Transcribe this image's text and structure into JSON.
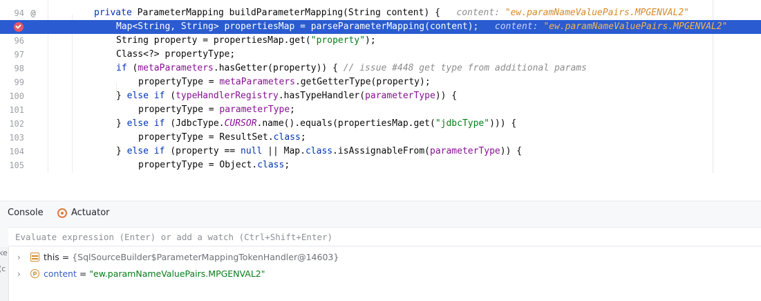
{
  "editor": {
    "lines": [
      {
        "num": "94",
        "marker": "@",
        "current": false,
        "indent": 136,
        "tokens": [
          {
            "t": "private ",
            "c": "k"
          },
          {
            "t": "ParameterMapping buildParameterMapping(String content) {",
            "c": ""
          }
        ],
        "hint_label": "content: ",
        "hint_value": "\"ew.paramNameValuePairs.MPGENVAL2\""
      },
      {
        "num": "",
        "marker": "",
        "current": true,
        "indent": 168,
        "breakpoint": true,
        "tokens": [
          {
            "t": "Map<String, String> propertiesMap = parseParameterMapping(content);",
            "c": ""
          }
        ],
        "hint_label": "content: ",
        "hint_value": "\"ew.paramNameValuePairs.MPGENVAL2\""
      },
      {
        "num": "96",
        "marker": "",
        "current": false,
        "indent": 168,
        "tokens": [
          {
            "t": "String property = propertiesMap.get(",
            "c": ""
          },
          {
            "t": "\"property\"",
            "c": "s"
          },
          {
            "t": ");",
            "c": ""
          }
        ]
      },
      {
        "num": "97",
        "marker": "",
        "current": false,
        "indent": 168,
        "tokens": [
          {
            "t": "Class<?> propertyType;",
            "c": ""
          }
        ]
      },
      {
        "num": "98",
        "marker": "",
        "current": false,
        "indent": 168,
        "tokens": [
          {
            "t": "if ",
            "c": "k"
          },
          {
            "t": "(",
            "c": ""
          },
          {
            "t": "metaParameters",
            "c": "f"
          },
          {
            "t": ".hasGetter(property)) { ",
            "c": ""
          },
          {
            "t": "// issue #448 get type from additional params",
            "c": "c"
          }
        ]
      },
      {
        "num": "99",
        "marker": "",
        "current": false,
        "indent": 200,
        "tokens": [
          {
            "t": "propertyType = ",
            "c": ""
          },
          {
            "t": "metaParameters",
            "c": "f"
          },
          {
            "t": ".getGetterType(property);",
            "c": ""
          }
        ]
      },
      {
        "num": "100",
        "marker": "",
        "current": false,
        "indent": 168,
        "tokens": [
          {
            "t": "} ",
            "c": ""
          },
          {
            "t": "else if ",
            "c": "k"
          },
          {
            "t": "(",
            "c": ""
          },
          {
            "t": "typeHandlerRegistry",
            "c": "f"
          },
          {
            "t": ".hasTypeHandler(",
            "c": ""
          },
          {
            "t": "parameterType",
            "c": "f"
          },
          {
            "t": ")) {",
            "c": ""
          }
        ]
      },
      {
        "num": "101",
        "marker": "",
        "current": false,
        "indent": 200,
        "tokens": [
          {
            "t": "propertyType = ",
            "c": ""
          },
          {
            "t": "parameterType",
            "c": "f"
          },
          {
            "t": ";",
            "c": ""
          }
        ]
      },
      {
        "num": "102",
        "marker": "",
        "current": false,
        "indent": 168,
        "tokens": [
          {
            "t": "} ",
            "c": ""
          },
          {
            "t": "else if ",
            "c": "k"
          },
          {
            "t": "(JdbcType.",
            "c": ""
          },
          {
            "t": "CURSOR",
            "c": "st"
          },
          {
            "t": ".name().equals(propertiesMap.get(",
            "c": ""
          },
          {
            "t": "\"jdbcType\"",
            "c": "s"
          },
          {
            "t": "))) {",
            "c": ""
          }
        ]
      },
      {
        "num": "103",
        "marker": "",
        "current": false,
        "indent": 200,
        "tokens": [
          {
            "t": "propertyType = ResultSet.",
            "c": ""
          },
          {
            "t": "class",
            "c": "k"
          },
          {
            "t": ";",
            "c": ""
          }
        ]
      },
      {
        "num": "104",
        "marker": "",
        "current": false,
        "indent": 168,
        "tokens": [
          {
            "t": "} ",
            "c": ""
          },
          {
            "t": "else if ",
            "c": "k"
          },
          {
            "t": "(property == ",
            "c": ""
          },
          {
            "t": "null ",
            "c": "k"
          },
          {
            "t": "|| Map.",
            "c": ""
          },
          {
            "t": "class",
            "c": "k"
          },
          {
            "t": ".isAssignableFrom(",
            "c": ""
          },
          {
            "t": "parameterType",
            "c": "f"
          },
          {
            "t": ")) {",
            "c": ""
          }
        ]
      },
      {
        "num": "105",
        "marker": "",
        "current": false,
        "indent": 200,
        "tokens": [
          {
            "t": "propertyType = Object.",
            "c": ""
          },
          {
            "t": "class",
            "c": "k"
          },
          {
            "t": ";",
            "c": ""
          }
        ]
      }
    ]
  },
  "panel": {
    "tabs": {
      "console": "Console",
      "actuator": "Actuator"
    },
    "evaluate_placeholder": "Evaluate expression (Enter) or add a watch (Ctrl+Shift+Enter)",
    "left_strip": [
      "ke",
      "(c"
    ],
    "variables": [
      {
        "icon": "field",
        "name": "this",
        "eq": " = ",
        "value": "{SqlSourceBuilder$ParameterMappingTokenHandler@14603}",
        "is_string": false
      },
      {
        "icon": "param",
        "name": "content",
        "eq": " = ",
        "value": "\"ew.paramNameValuePairs.MPGENVAL2\"",
        "is_string": true
      }
    ]
  },
  "colors": {
    "current_line": "#2a5bd1",
    "keyword": "#0033b3",
    "field": "#871094",
    "string": "#067d17",
    "inline_value": "#d48a2a",
    "breakpoint": "#e55765"
  }
}
